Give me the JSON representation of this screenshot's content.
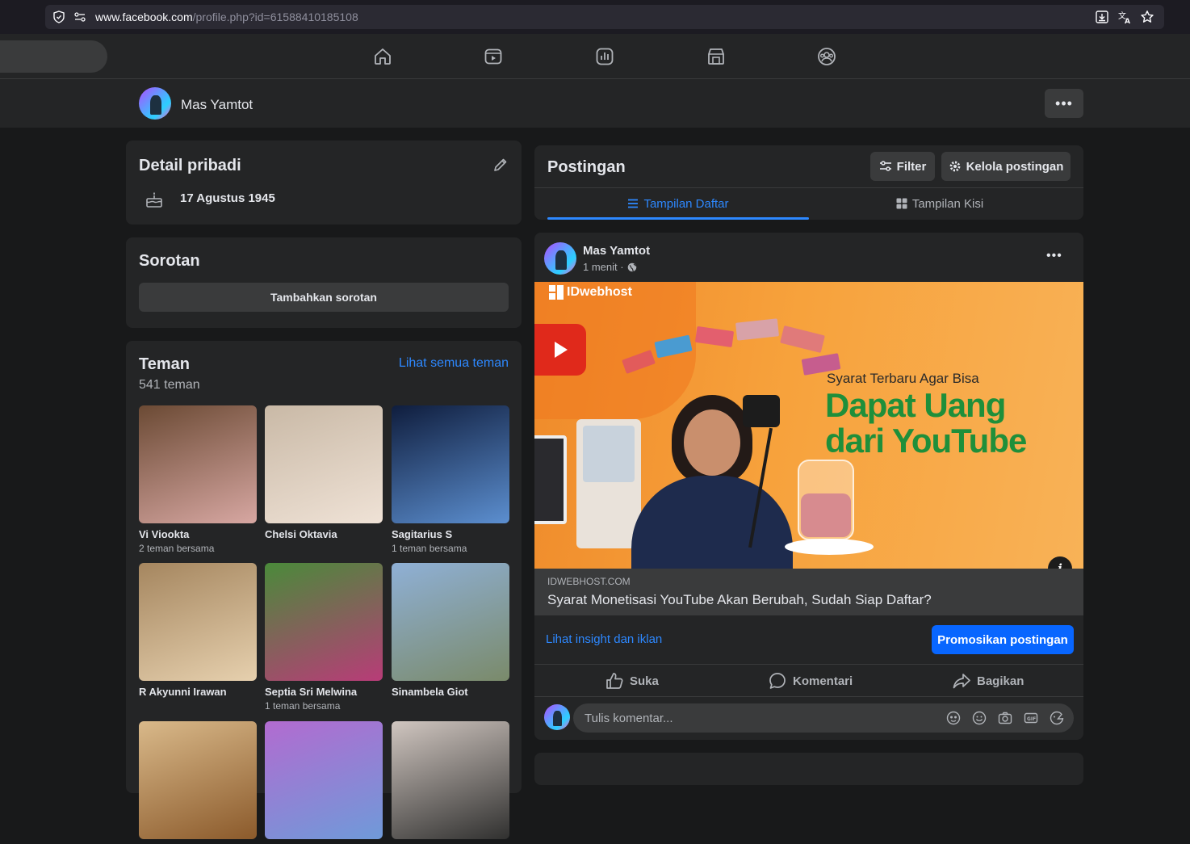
{
  "browser": {
    "url_domain": "www.facebook.com",
    "url_path": "/profile.php?id=61588410185108"
  },
  "nav": {
    "icons": [
      "home-icon",
      "video-icon",
      "gaming-icon",
      "marketplace-icon",
      "groups-icon"
    ]
  },
  "profile_bar": {
    "name": "Mas Yamtot",
    "more": "•••"
  },
  "detail": {
    "title": "Detail pribadi",
    "birthday": "17 Agustus 1945"
  },
  "sorotan": {
    "title": "Sorotan",
    "button": "Tambahkan sorotan"
  },
  "friends": {
    "title": "Teman",
    "count": "541 teman",
    "see_all": "Lihat semua teman",
    "items": [
      {
        "name": "Vi Viookta",
        "mutual": "2 teman bersama",
        "c1": "#6b4a34",
        "c2": "#d7a7a2"
      },
      {
        "name": "Chelsi Oktavia",
        "mutual": "",
        "c1": "#c9b9a6",
        "c2": "#efe2d6"
      },
      {
        "name": "Sagitarius S",
        "mutual": "1 teman bersama",
        "c1": "#0f1d3d",
        "c2": "#5c8fd0"
      },
      {
        "name": "R Akyunni Irawan",
        "mutual": "",
        "c1": "#a5865f",
        "c2": "#e6d0ae"
      },
      {
        "name": "Septia Sri Melwina",
        "mutual": "1 teman bersama",
        "c1": "#4a8a3a",
        "c2": "#b83c78"
      },
      {
        "name": "Sinambela Giot",
        "mutual": "",
        "c1": "#8fb0d6",
        "c2": "#7a8a6a"
      },
      {
        "name": "",
        "mutual": "",
        "c1": "#d9b98a",
        "c2": "#8b5a2b"
      },
      {
        "name": "",
        "mutual": "",
        "c1": "#b26bd0",
        "c2": "#6f9ad9"
      },
      {
        "name": "",
        "mutual": "",
        "c1": "#d0c6c0",
        "c2": "#30302f"
      }
    ]
  },
  "posts_header": {
    "title": "Postingan",
    "filter": "Filter",
    "manage": "Kelola postingan",
    "tab_list": "Tampilan Daftar",
    "tab_grid": "Tampilan Kisi"
  },
  "post": {
    "author": "Mas Yamtot",
    "time": "1 menit ·",
    "more": "•••",
    "ad_brand": "IDwebhost",
    "ad_small": "Syarat Terbaru Agar Bisa",
    "ad_big1": "Dapat Uang",
    "ad_big2": "dari YouTube",
    "link_domain": "IDWEBHOST.COM",
    "link_title": "Syarat Monetisasi YouTube Akan Berubah, Sudah Siap Daftar?",
    "insight": "Lihat insight dan iklan",
    "promote": "Promosikan postingan",
    "like": "Suka",
    "comment": "Komentari",
    "share": "Bagikan",
    "comment_placeholder": "Tulis komentar..."
  },
  "colors": {
    "accent": "#2d88ff",
    "promote_bg": "#0866ff",
    "ad_orange": "#f29a35",
    "ad_green": "#1f8f3a"
  }
}
